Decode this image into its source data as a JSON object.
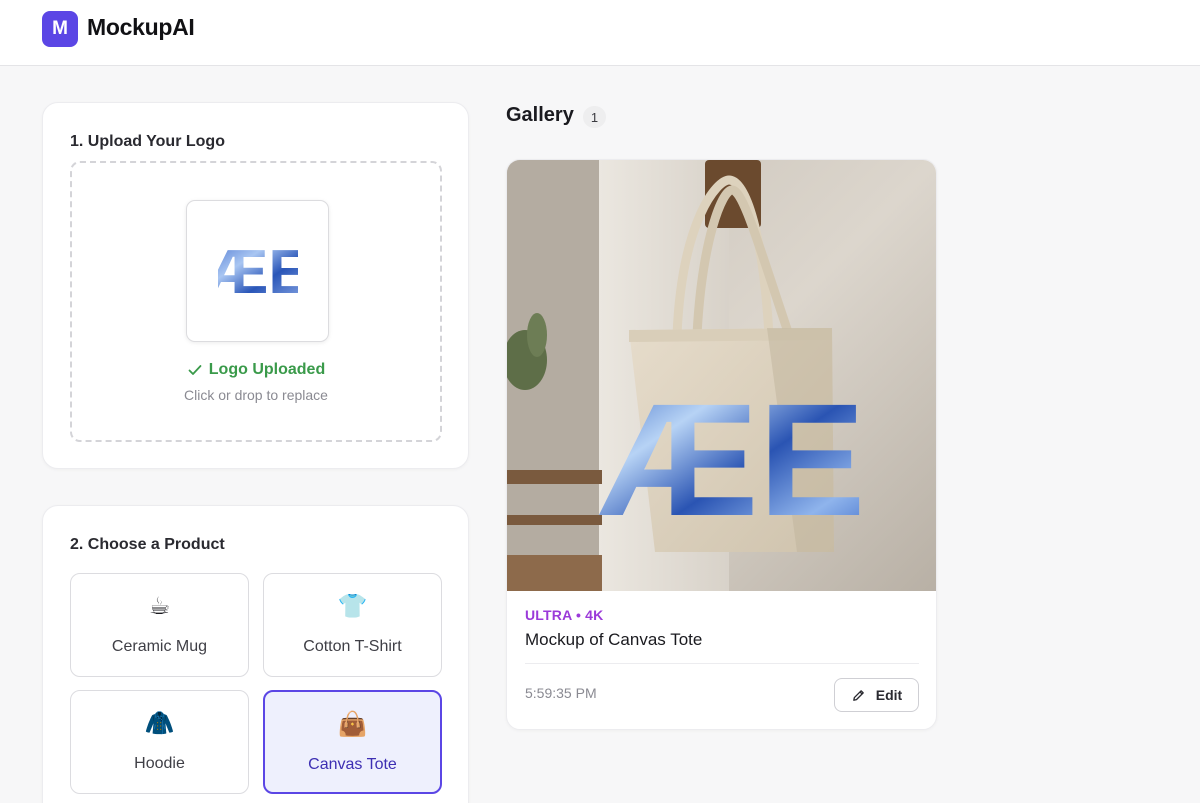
{
  "app": {
    "badge": "M",
    "title": "MockupAI"
  },
  "upload": {
    "title": "1. Upload Your Logo",
    "logo_text": "ÆE",
    "status": "Logo Uploaded",
    "hint": "Click or drop to replace"
  },
  "products": {
    "title": "2. Choose a Product",
    "items": [
      {
        "label": "Ceramic Mug",
        "emoji": "☕",
        "selected": false
      },
      {
        "label": "Cotton T-Shirt",
        "emoji": "👕",
        "selected": false
      },
      {
        "label": "Hoodie",
        "emoji": "🧥",
        "selected": false
      },
      {
        "label": "Canvas Tote",
        "emoji": "👜",
        "selected": true
      }
    ]
  },
  "gallery": {
    "title": "Gallery",
    "count": "1",
    "items": [
      {
        "quality": "ULTRA • 4K",
        "name": "Mockup of Canvas Tote",
        "time": "5:59:35 PM",
        "edit_label": "Edit"
      }
    ]
  },
  "colors": {
    "accent": "#5b46e5",
    "success": "#3a9a4a",
    "quality": "#9b3ad9"
  }
}
